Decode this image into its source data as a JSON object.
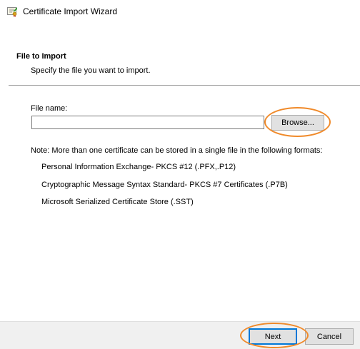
{
  "window": {
    "title": "Certificate Import Wizard"
  },
  "section": {
    "heading": "File to Import",
    "description": "Specify the file you want to import."
  },
  "file": {
    "label": "File name:",
    "value": "",
    "placeholder": ""
  },
  "buttons": {
    "browse": "Browse...",
    "next": "Next",
    "cancel": "Cancel"
  },
  "note": "Note:  More than one certificate can be stored in a single file in the following formats:",
  "formats": [
    "Personal Information Exchange- PKCS #12 (.PFX,.P12)",
    "Cryptographic Message Syntax Standard- PKCS #7 Certificates (.P7B)",
    "Microsoft Serialized Certificate Store (.SST)"
  ],
  "colors": {
    "highlight_ring": "#f08a2a",
    "default_button_border": "#0078d7",
    "footer_background": "#f0f0f0"
  },
  "icons": {
    "title": "certificate-icon"
  }
}
